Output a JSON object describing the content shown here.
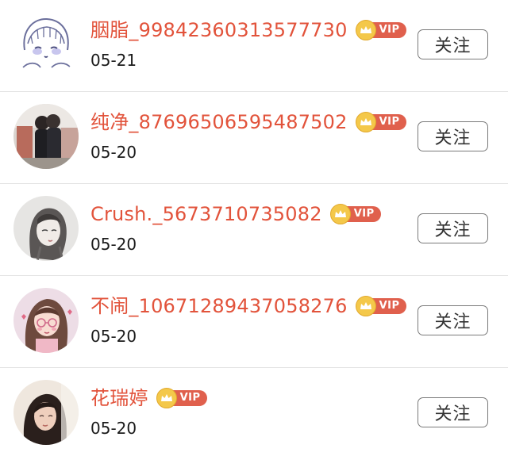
{
  "follow_list": [
    {
      "name": "胭脂_99842360313577730",
      "badge": "VIP",
      "date": "05-21",
      "follow_label": "关注",
      "avatar": "cartoon-girl-avatar"
    },
    {
      "name": "纯净_87696506595487502",
      "badge": "VIP",
      "date": "05-20",
      "follow_label": "关注",
      "avatar": "couple-photo-avatar"
    },
    {
      "name": "Crush._5673710735082",
      "badge": "VIP",
      "date": "05-20",
      "follow_label": "关注",
      "avatar": "sketch-girl-avatar"
    },
    {
      "name": "不闹_10671289437058276",
      "badge": "VIP",
      "date": "05-20",
      "follow_label": "关注",
      "avatar": "anime-girl-avatar"
    },
    {
      "name": "花瑞婷",
      "badge": "VIP",
      "date": "05-20",
      "follow_label": "关注",
      "avatar": "portrait-photo-avatar"
    }
  ],
  "colors": {
    "name": "#e2533b",
    "vip_pill": "#e0604d",
    "vip_crown": "#f4c84a",
    "divider": "#e3e3e3",
    "button_border": "#7a7a7a"
  }
}
